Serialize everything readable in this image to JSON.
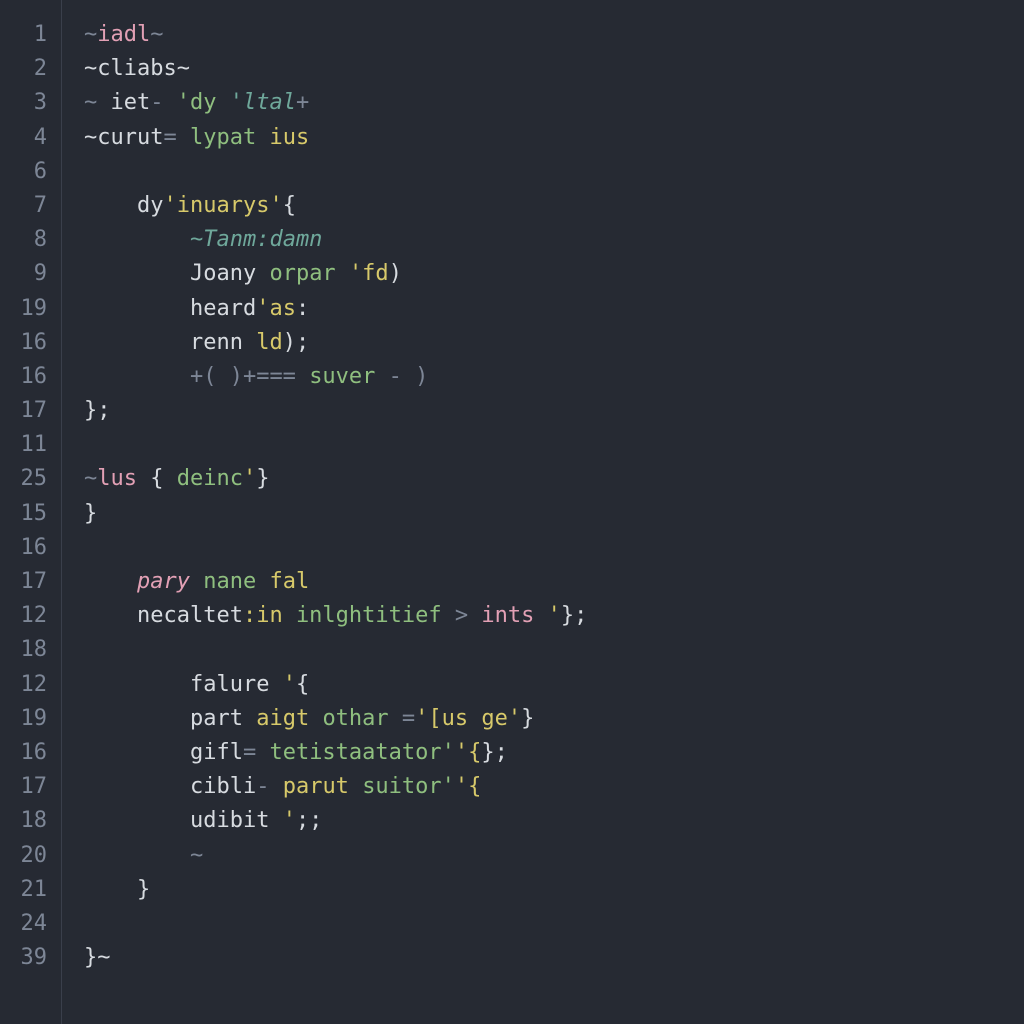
{
  "gutter": [
    "1",
    "2",
    "3",
    "4",
    "6",
    "7",
    "8",
    "9",
    "19",
    "16",
    "16",
    "17",
    "11",
    "25",
    "15",
    "16",
    "17",
    "12",
    "18",
    "12",
    "19",
    "16",
    "17",
    "18",
    "20",
    "21",
    "24",
    "39"
  ],
  "lines": [
    {
      "indent": 0,
      "tokens": [
        {
          "t": "~",
          "c": "tk-dim"
        },
        {
          "t": "iadl",
          "c": "tk-pink"
        },
        {
          "t": "~",
          "c": "tk-dim"
        }
      ]
    },
    {
      "indent": 0,
      "tokens": [
        {
          "t": "~cliabs~",
          "c": ""
        }
      ]
    },
    {
      "indent": 0,
      "tokens": [
        {
          "t": "~ ",
          "c": "tk-dim"
        },
        {
          "t": "iet",
          "c": ""
        },
        {
          "t": "- ",
          "c": "tk-dim"
        },
        {
          "t": "'dy ",
          "c": "tk-green"
        },
        {
          "t": "'ltal",
          "c": "tk-teal"
        },
        {
          "t": "+",
          "c": "tk-dim"
        }
      ]
    },
    {
      "indent": 0,
      "tokens": [
        {
          "t": "~curut",
          "c": ""
        },
        {
          "t": "= ",
          "c": "tk-dim"
        },
        {
          "t": "lypat ",
          "c": "tk-green"
        },
        {
          "t": "ius",
          "c": "tk-yellow"
        }
      ]
    },
    {
      "indent": 0,
      "tokens": []
    },
    {
      "indent": 1,
      "tokens": [
        {
          "t": "dy",
          "c": ""
        },
        {
          "t": "'inuarys'",
          "c": "tk-yellow"
        },
        {
          "t": "{",
          "c": ""
        }
      ]
    },
    {
      "indent": 2,
      "tokens": [
        {
          "t": "~Tanm",
          "c": "tk-teal"
        },
        {
          "t": ":damn",
          "c": "tk-teal"
        }
      ]
    },
    {
      "indent": 2,
      "tokens": [
        {
          "t": "Joany ",
          "c": ""
        },
        {
          "t": "orpar ",
          "c": "tk-green"
        },
        {
          "t": "'fd",
          "c": "tk-yellow"
        },
        {
          "t": ")",
          "c": ""
        }
      ]
    },
    {
      "indent": 2,
      "tokens": [
        {
          "t": "heard",
          "c": ""
        },
        {
          "t": "'as",
          "c": "tk-yellow"
        },
        {
          "t": ":",
          "c": ""
        }
      ]
    },
    {
      "indent": 2,
      "tokens": [
        {
          "t": "renn ",
          "c": ""
        },
        {
          "t": "ld",
          "c": "tk-yellow"
        },
        {
          "t": ");",
          "c": ""
        }
      ]
    },
    {
      "indent": 2,
      "tokens": [
        {
          "t": "+( )+=== ",
          "c": "tk-dim"
        },
        {
          "t": "suver",
          "c": "tk-green"
        },
        {
          "t": " - )",
          "c": "tk-dim"
        }
      ]
    },
    {
      "indent": 0,
      "tokens": [
        {
          "t": "};",
          "c": ""
        }
      ]
    },
    {
      "indent": 0,
      "tokens": []
    },
    {
      "indent": 0,
      "tokens": [
        {
          "t": "~",
          "c": "tk-dim"
        },
        {
          "t": "lus ",
          "c": "tk-pink"
        },
        {
          "t": "{ ",
          "c": ""
        },
        {
          "t": "deinc",
          "c": "tk-green"
        },
        {
          "t": "'",
          "c": "tk-yellow"
        },
        {
          "t": "}",
          "c": ""
        }
      ]
    },
    {
      "indent": 0,
      "tokens": [
        {
          "t": "}",
          "c": ""
        }
      ]
    },
    {
      "indent": 0,
      "tokens": []
    },
    {
      "indent": 1,
      "tokens": [
        {
          "t": "pary ",
          "c": "tk-pink tk-em"
        },
        {
          "t": "nane ",
          "c": "tk-green"
        },
        {
          "t": "fal",
          "c": "tk-yellow"
        }
      ]
    },
    {
      "indent": 1,
      "tokens": [
        {
          "t": "necaltet",
          "c": ""
        },
        {
          "t": ":in ",
          "c": "tk-yellow"
        },
        {
          "t": "inlghtitief ",
          "c": "tk-green"
        },
        {
          "t": "> ",
          "c": "tk-dim"
        },
        {
          "t": "ints ",
          "c": "tk-pink"
        },
        {
          "t": "'",
          "c": "tk-yellow"
        },
        {
          "t": "};",
          "c": ""
        }
      ]
    },
    {
      "indent": 0,
      "tokens": []
    },
    {
      "indent": 2,
      "tokens": [
        {
          "t": "falure ",
          "c": ""
        },
        {
          "t": "'",
          "c": "tk-yellow"
        },
        {
          "t": "{",
          "c": ""
        }
      ]
    },
    {
      "indent": 2,
      "tokens": [
        {
          "t": "part ",
          "c": ""
        },
        {
          "t": "aigt ",
          "c": "tk-yellow"
        },
        {
          "t": "othar ",
          "c": "tk-green"
        },
        {
          "t": "=",
          "c": "tk-dim"
        },
        {
          "t": "'[us ge'",
          "c": "tk-yellow"
        },
        {
          "t": "}",
          "c": ""
        }
      ]
    },
    {
      "indent": 2,
      "tokens": [
        {
          "t": "gifl",
          "c": ""
        },
        {
          "t": "= ",
          "c": "tk-dim"
        },
        {
          "t": "tetistaatator'",
          "c": "tk-green"
        },
        {
          "t": "'{",
          "c": "tk-yellow"
        },
        {
          "t": "};",
          "c": ""
        }
      ]
    },
    {
      "indent": 2,
      "tokens": [
        {
          "t": "cibli",
          "c": ""
        },
        {
          "t": "- ",
          "c": "tk-dim"
        },
        {
          "t": "parut ",
          "c": "tk-yellow"
        },
        {
          "t": "suitor'",
          "c": "tk-green"
        },
        {
          "t": "'{",
          "c": "tk-yellow"
        }
      ]
    },
    {
      "indent": 2,
      "tokens": [
        {
          "t": "udibit ",
          "c": ""
        },
        {
          "t": "'",
          "c": "tk-yellow"
        },
        {
          "t": ";;",
          "c": ""
        }
      ]
    },
    {
      "indent": 2,
      "tokens": [
        {
          "t": "~",
          "c": "tk-dim"
        }
      ]
    },
    {
      "indent": 1,
      "tokens": [
        {
          "t": "}",
          "c": ""
        }
      ]
    },
    {
      "indent": 0,
      "tokens": []
    },
    {
      "indent": 0,
      "tokens": [
        {
          "t": "}~",
          "c": ""
        }
      ]
    }
  ],
  "indent_unit": "    "
}
